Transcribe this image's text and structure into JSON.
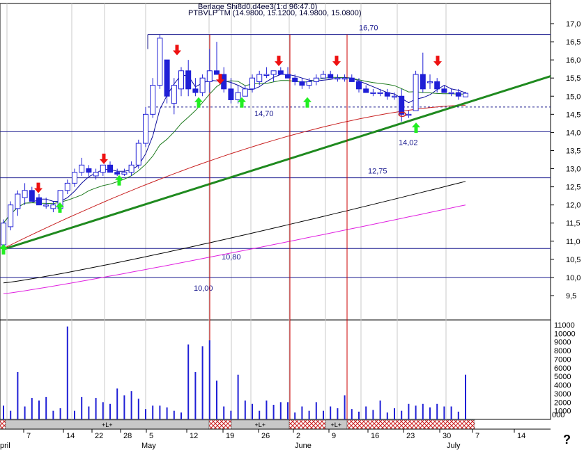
{
  "header": {
    "title_overlap": "Berlage Shi8d0.d4ee3(1:d 96:47.0)",
    "series_line": "PTBVLP TM (14.9800, 15.1200, 14.9800, 15.0800)"
  },
  "help_glyph": "?",
  "colors": {
    "candle": "#1f1fd6",
    "ma_fast": "#0a0a9a",
    "ma_green": "#1e7a1e",
    "ma_red": "#c82020",
    "ma_black": "#000000",
    "ma_magenta": "#e020e0",
    "trend": "#1f8a1f",
    "level": "#1b1b8f",
    "event_line": "#cc0000",
    "grid": "#c8c8c8",
    "up_arrow": "#22ee22",
    "down_arrow": "#ee1111"
  },
  "chart_data": {
    "type": "candlestick",
    "price_axis": {
      "ylim": [
        9.3,
        17.3
      ],
      "ticks": [
        "17,0",
        "16,5",
        "16,0",
        "15,5",
        "15,0",
        "14,5",
        "14,0",
        "13,5",
        "13,0",
        "12,5",
        "12,0",
        "11,5",
        "11,0",
        "10,5",
        "10,0",
        "9,5"
      ]
    },
    "volume_axis": {
      "ylim": [
        0,
        11000
      ],
      "ticks": [
        "11000",
        "10000",
        "9000",
        "8000",
        "7000",
        "6000",
        "5000",
        "4000",
        "3000",
        "2000",
        "1000"
      ]
    },
    "x_ticks": [
      "7",
      "14",
      "22",
      "28",
      "5",
      "12",
      "19",
      "26",
      "2",
      "9",
      "16",
      "23",
      "30",
      "7",
      "14"
    ],
    "month_labels": [
      "pril",
      "May",
      "June",
      "July"
    ],
    "level_lines": [
      {
        "value": 16.7,
        "label": "16,70"
      },
      {
        "value": 14.7,
        "label": "14,70",
        "dashed": true
      },
      {
        "value": 14.02,
        "label": "14,02"
      },
      {
        "value": 12.75,
        "label": "12,75"
      },
      {
        "value": 10.8,
        "label": "10,80"
      },
      {
        "value": 10.0,
        "label": "10,00"
      }
    ],
    "candles": [
      [
        10.9,
        11.6,
        10.9,
        11.5
      ],
      [
        11.4,
        12.1,
        11.3,
        12.0
      ],
      [
        11.9,
        12.4,
        11.7,
        12.3
      ],
      [
        12.2,
        12.6,
        12.0,
        12.4
      ],
      [
        12.4,
        12.5,
        12.1,
        12.1
      ],
      [
        12.2,
        12.3,
        12.0,
        12.0
      ],
      [
        12.0,
        12.2,
        11.9,
        12.0
      ],
      [
        11.9,
        12.1,
        11.8,
        12.0
      ],
      [
        11.9,
        12.4,
        11.8,
        12.4
      ],
      [
        12.4,
        12.7,
        12.3,
        12.6
      ],
      [
        12.6,
        13.0,
        12.5,
        12.9
      ],
      [
        12.9,
        13.3,
        12.8,
        13.1
      ],
      [
        13.0,
        13.1,
        12.8,
        12.9
      ],
      [
        12.8,
        13.0,
        12.7,
        12.9
      ],
      [
        12.9,
        13.1,
        12.8,
        13.1
      ],
      [
        13.1,
        13.2,
        12.9,
        12.9
      ],
      [
        12.9,
        13.0,
        12.8,
        12.85
      ],
      [
        12.85,
        13.0,
        12.8,
        12.9
      ],
      [
        12.9,
        13.2,
        12.8,
        13.1
      ],
      [
        13.1,
        13.8,
        13.0,
        13.7
      ],
      [
        13.7,
        14.7,
        13.6,
        14.5
      ],
      [
        14.5,
        15.5,
        14.4,
        15.3
      ],
      [
        15.3,
        16.7,
        15.2,
        16.6
      ],
      [
        16.0,
        16.0,
        14.8,
        15.0
      ],
      [
        14.8,
        15.5,
        14.5,
        15.3
      ],
      [
        15.2,
        15.8,
        15.0,
        15.7
      ],
      [
        15.7,
        16.0,
        15.0,
        15.2
      ],
      [
        15.2,
        15.5,
        15.0,
        15.1
      ],
      [
        15.1,
        15.6,
        15.0,
        15.5
      ],
      [
        15.4,
        16.3,
        15.1,
        15.7
      ],
      [
        15.7,
        16.5,
        15.6,
        15.6
      ],
      [
        15.6,
        15.8,
        15.1,
        15.2
      ],
      [
        15.2,
        15.5,
        14.8,
        14.9
      ],
      [
        14.9,
        15.3,
        14.8,
        15.1
      ],
      [
        15.0,
        15.3,
        15.0,
        15.2
      ],
      [
        15.2,
        15.6,
        15.1,
        15.5
      ],
      [
        15.4,
        15.7,
        15.3,
        15.6
      ],
      [
        15.6,
        15.8,
        15.5,
        15.6
      ],
      [
        15.6,
        15.7,
        15.4,
        15.7
      ],
      [
        15.7,
        15.8,
        15.6,
        15.6
      ],
      [
        15.6,
        15.8,
        15.5,
        15.5
      ],
      [
        15.5,
        15.6,
        15.3,
        15.4
      ],
      [
        15.4,
        15.5,
        15.2,
        15.3
      ],
      [
        15.3,
        15.5,
        15.2,
        15.4
      ],
      [
        15.4,
        15.6,
        15.3,
        15.5
      ],
      [
        15.5,
        15.7,
        15.5,
        15.6
      ],
      [
        15.6,
        15.7,
        15.5,
        15.5
      ],
      [
        15.5,
        15.6,
        15.4,
        15.5
      ],
      [
        15.5,
        15.6,
        15.4,
        15.5
      ],
      [
        15.5,
        15.6,
        15.4,
        15.4
      ],
      [
        15.4,
        15.5,
        15.1,
        15.2
      ],
      [
        15.2,
        15.3,
        15.1,
        15.1
      ],
      [
        15.1,
        15.2,
        15.0,
        15.1
      ],
      [
        15.1,
        15.2,
        15.0,
        15.1
      ],
      [
        15.1,
        15.2,
        14.9,
        15.0
      ],
      [
        15.0,
        15.1,
        14.9,
        15.0
      ],
      [
        15.0,
        15.2,
        14.3,
        14.5
      ],
      [
        14.5,
        14.6,
        14.4,
        14.5
      ],
      [
        14.6,
        15.7,
        14.6,
        15.6
      ],
      [
        15.6,
        16.2,
        15.1,
        15.2
      ],
      [
        15.4,
        15.6,
        15.2,
        15.4
      ],
      [
        15.4,
        15.5,
        15.1,
        15.2
      ],
      [
        15.2,
        15.3,
        15.1,
        15.1
      ],
      [
        15.1,
        15.2,
        15.0,
        15.1
      ],
      [
        15.1,
        15.2,
        14.9,
        15.0
      ],
      [
        14.98,
        15.12,
        14.98,
        15.08
      ]
    ],
    "volumes": [
      1600,
      1000,
      5500,
      1500,
      2500,
      2200,
      2600,
      1000,
      1300,
      10800,
      1000,
      2600,
      1500,
      2500,
      2000,
      1800,
      3600,
      2800,
      3300,
      2400,
      1200,
      1600,
      1600,
      1400,
      1000,
      800,
      8700,
      5500,
      8500,
      9200,
      4500,
      1500,
      1000,
      5200,
      2200,
      1800,
      1000,
      2200,
      1700,
      2000,
      2000,
      800,
      1500,
      1000,
      2000,
      1000,
      1500,
      1300,
      2800,
      1200,
      900,
      1500,
      1100,
      2200,
      800,
      1300,
      1000,
      1800,
      1600,
      1800,
      1400,
      1800,
      1500,
      1500,
      900,
      5200
    ],
    "arrows": [
      {
        "dir": "up",
        "x": 5,
        "y": 10.75
      },
      {
        "dir": "down",
        "x": 55,
        "y": 12.5
      },
      {
        "dir": "up",
        "x": 86,
        "y": 11.9
      },
      {
        "dir": "down",
        "x": 149,
        "y": 13.3
      },
      {
        "dir": "up",
        "x": 171,
        "y": 12.65
      },
      {
        "dir": "down",
        "x": 254,
        "y": 16.3
      },
      {
        "dir": "up",
        "x": 285,
        "y": 14.8
      },
      {
        "dir": "down",
        "x": 316,
        "y": 15.5
      },
      {
        "dir": "up",
        "x": 347,
        "y": 14.8
      },
      {
        "dir": "down",
        "x": 400,
        "y": 16.0
      },
      {
        "dir": "up",
        "x": 441,
        "y": 14.8
      },
      {
        "dir": "down",
        "x": 483,
        "y": 16.0
      },
      {
        "dir": "up",
        "x": 597,
        "y": 14.1
      },
      {
        "dir": "down",
        "x": 628,
        "y": 16.0
      }
    ],
    "event_lines_x": [
      301,
      416,
      498
    ],
    "bottom_band": [
      {
        "from": 0,
        "to": 8,
        "hatched": true,
        "label": ""
      },
      {
        "from": 8,
        "to": 300,
        "hatched": false,
        "label": "+L+"
      },
      {
        "from": 300,
        "to": 332,
        "hatched": true,
        "label": ""
      },
      {
        "from": 332,
        "to": 415,
        "hatched": false,
        "label": "+L+"
      },
      {
        "from": 415,
        "to": 467,
        "hatched": true,
        "label": ""
      },
      {
        "from": 467,
        "to": 498,
        "hatched": false,
        "label": "+L+"
      },
      {
        "from": 498,
        "to": 681,
        "hatched": true,
        "label": ""
      }
    ]
  }
}
